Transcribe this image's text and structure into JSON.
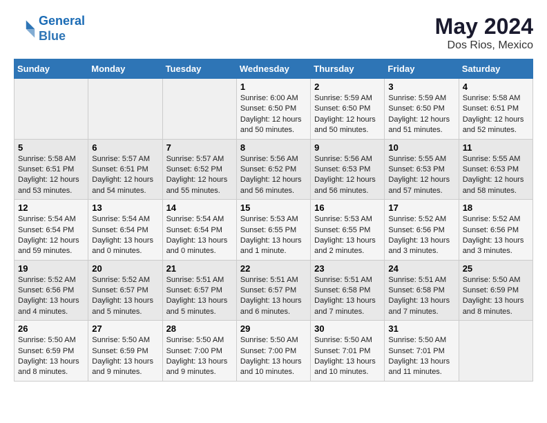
{
  "logo": {
    "line1": "General",
    "line2": "Blue"
  },
  "title": "May 2024",
  "location": "Dos Rios, Mexico",
  "days_of_week": [
    "Sunday",
    "Monday",
    "Tuesday",
    "Wednesday",
    "Thursday",
    "Friday",
    "Saturday"
  ],
  "weeks": [
    [
      {
        "day": "",
        "info": ""
      },
      {
        "day": "",
        "info": ""
      },
      {
        "day": "",
        "info": ""
      },
      {
        "day": "1",
        "info": "Sunrise: 6:00 AM\nSunset: 6:50 PM\nDaylight: 12 hours\nand 50 minutes."
      },
      {
        "day": "2",
        "info": "Sunrise: 5:59 AM\nSunset: 6:50 PM\nDaylight: 12 hours\nand 50 minutes."
      },
      {
        "day": "3",
        "info": "Sunrise: 5:59 AM\nSunset: 6:50 PM\nDaylight: 12 hours\nand 51 minutes."
      },
      {
        "day": "4",
        "info": "Sunrise: 5:58 AM\nSunset: 6:51 PM\nDaylight: 12 hours\nand 52 minutes."
      }
    ],
    [
      {
        "day": "5",
        "info": "Sunrise: 5:58 AM\nSunset: 6:51 PM\nDaylight: 12 hours\nand 53 minutes."
      },
      {
        "day": "6",
        "info": "Sunrise: 5:57 AM\nSunset: 6:51 PM\nDaylight: 12 hours\nand 54 minutes."
      },
      {
        "day": "7",
        "info": "Sunrise: 5:57 AM\nSunset: 6:52 PM\nDaylight: 12 hours\nand 55 minutes."
      },
      {
        "day": "8",
        "info": "Sunrise: 5:56 AM\nSunset: 6:52 PM\nDaylight: 12 hours\nand 56 minutes."
      },
      {
        "day": "9",
        "info": "Sunrise: 5:56 AM\nSunset: 6:53 PM\nDaylight: 12 hours\nand 56 minutes."
      },
      {
        "day": "10",
        "info": "Sunrise: 5:55 AM\nSunset: 6:53 PM\nDaylight: 12 hours\nand 57 minutes."
      },
      {
        "day": "11",
        "info": "Sunrise: 5:55 AM\nSunset: 6:53 PM\nDaylight: 12 hours\nand 58 minutes."
      }
    ],
    [
      {
        "day": "12",
        "info": "Sunrise: 5:54 AM\nSunset: 6:54 PM\nDaylight: 12 hours\nand 59 minutes."
      },
      {
        "day": "13",
        "info": "Sunrise: 5:54 AM\nSunset: 6:54 PM\nDaylight: 13 hours\nand 0 minutes."
      },
      {
        "day": "14",
        "info": "Sunrise: 5:54 AM\nSunset: 6:54 PM\nDaylight: 13 hours\nand 0 minutes."
      },
      {
        "day": "15",
        "info": "Sunrise: 5:53 AM\nSunset: 6:55 PM\nDaylight: 13 hours\nand 1 minute."
      },
      {
        "day": "16",
        "info": "Sunrise: 5:53 AM\nSunset: 6:55 PM\nDaylight: 13 hours\nand 2 minutes."
      },
      {
        "day": "17",
        "info": "Sunrise: 5:52 AM\nSunset: 6:56 PM\nDaylight: 13 hours\nand 3 minutes."
      },
      {
        "day": "18",
        "info": "Sunrise: 5:52 AM\nSunset: 6:56 PM\nDaylight: 13 hours\nand 3 minutes."
      }
    ],
    [
      {
        "day": "19",
        "info": "Sunrise: 5:52 AM\nSunset: 6:56 PM\nDaylight: 13 hours\nand 4 minutes."
      },
      {
        "day": "20",
        "info": "Sunrise: 5:52 AM\nSunset: 6:57 PM\nDaylight: 13 hours\nand 5 minutes."
      },
      {
        "day": "21",
        "info": "Sunrise: 5:51 AM\nSunset: 6:57 PM\nDaylight: 13 hours\nand 5 minutes."
      },
      {
        "day": "22",
        "info": "Sunrise: 5:51 AM\nSunset: 6:57 PM\nDaylight: 13 hours\nand 6 minutes."
      },
      {
        "day": "23",
        "info": "Sunrise: 5:51 AM\nSunset: 6:58 PM\nDaylight: 13 hours\nand 7 minutes."
      },
      {
        "day": "24",
        "info": "Sunrise: 5:51 AM\nSunset: 6:58 PM\nDaylight: 13 hours\nand 7 minutes."
      },
      {
        "day": "25",
        "info": "Sunrise: 5:50 AM\nSunset: 6:59 PM\nDaylight: 13 hours\nand 8 minutes."
      }
    ],
    [
      {
        "day": "26",
        "info": "Sunrise: 5:50 AM\nSunset: 6:59 PM\nDaylight: 13 hours\nand 8 minutes."
      },
      {
        "day": "27",
        "info": "Sunrise: 5:50 AM\nSunset: 6:59 PM\nDaylight: 13 hours\nand 9 minutes."
      },
      {
        "day": "28",
        "info": "Sunrise: 5:50 AM\nSunset: 7:00 PM\nDaylight: 13 hours\nand 9 minutes."
      },
      {
        "day": "29",
        "info": "Sunrise: 5:50 AM\nSunset: 7:00 PM\nDaylight: 13 hours\nand 10 minutes."
      },
      {
        "day": "30",
        "info": "Sunrise: 5:50 AM\nSunset: 7:01 PM\nDaylight: 13 hours\nand 10 minutes."
      },
      {
        "day": "31",
        "info": "Sunrise: 5:50 AM\nSunset: 7:01 PM\nDaylight: 13 hours\nand 11 minutes."
      },
      {
        "day": "",
        "info": ""
      }
    ]
  ]
}
